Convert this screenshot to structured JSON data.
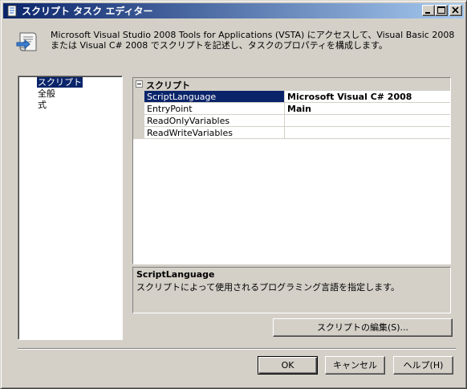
{
  "window": {
    "title": "スクリプト タスク エディター",
    "colors": {
      "title_active": "#0a246a",
      "title_gradient_end": "#a6caf0",
      "face": "#d4d0c8",
      "selection": "#0a246a"
    }
  },
  "header": {
    "description": "Microsoft Visual Studio 2008 Tools for Applications (VSTA) にアクセスして、Visual Basic 2008 または Visual C# 2008 でスクリプトを記述し、タスクのプロパティを構成します。",
    "icon": "script-scroll-icon"
  },
  "nav": {
    "items": [
      {
        "label": "スクリプト",
        "selected": true
      },
      {
        "label": "全般",
        "selected": false
      },
      {
        "label": "式",
        "selected": false
      }
    ]
  },
  "grid": {
    "category": "スクリプト",
    "rows": [
      {
        "name": "ScriptLanguage",
        "value": "Microsoft Visual C# 2008",
        "selected": true
      },
      {
        "name": "EntryPoint",
        "value": "Main",
        "selected": false
      },
      {
        "name": "ReadOnlyVariables",
        "value": "",
        "selected": false
      },
      {
        "name": "ReadWriteVariables",
        "value": "",
        "selected": false
      }
    ]
  },
  "description_panel": {
    "title": "ScriptLanguage",
    "text": "スクリプトによって使用されるプログラミング言語を指定します。"
  },
  "buttons": {
    "edit_script": "スクリプトの編集(S)...",
    "ok": "OK",
    "cancel": "キャンセル",
    "help": "ヘルプ(H)"
  }
}
